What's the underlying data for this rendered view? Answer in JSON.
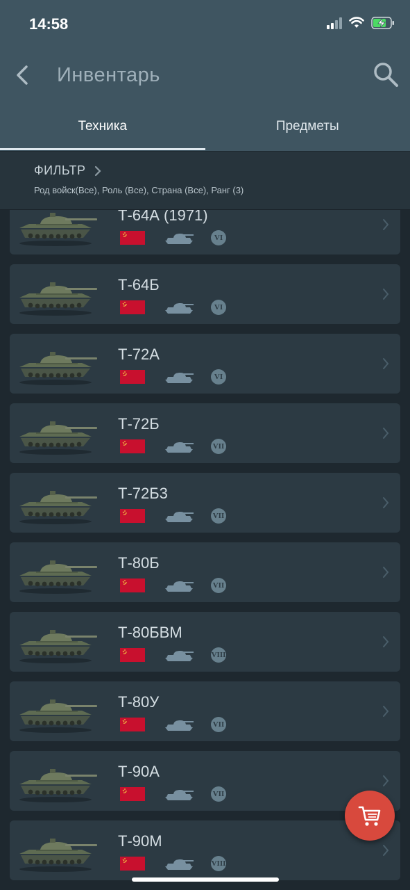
{
  "status": {
    "time": "14:58"
  },
  "nav": {
    "title": "Инвентарь"
  },
  "tabs": [
    {
      "label": "Техника",
      "active": true
    },
    {
      "label": "Предметы",
      "active": false
    }
  ],
  "filter": {
    "title": "ФИЛЬТР",
    "summary": "Род войск(Все), Роль (Все), Страна (Все), Ранг (3)"
  },
  "colors": {
    "accent_cart": "#d8493d",
    "flag": "#c8102e",
    "header": "#3f5561"
  },
  "vehicles": [
    {
      "name": "Т-64А (1971)",
      "country": "ussr-flag",
      "type": "tank-icon",
      "rank": "VI"
    },
    {
      "name": "Т-64Б",
      "country": "ussr-flag",
      "type": "tank-icon",
      "rank": "VI"
    },
    {
      "name": "Т-72А",
      "country": "ussr-flag",
      "type": "tank-icon",
      "rank": "VI"
    },
    {
      "name": "Т-72Б",
      "country": "ussr-flag",
      "type": "tank-icon",
      "rank": "VII"
    },
    {
      "name": "Т-72Б3",
      "country": "ussr-flag",
      "type": "tank-icon",
      "rank": "VII"
    },
    {
      "name": "Т-80Б",
      "country": "ussr-flag",
      "type": "tank-icon",
      "rank": "VII"
    },
    {
      "name": "Т-80БВМ",
      "country": "ussr-flag",
      "type": "tank-icon",
      "rank": "VIII"
    },
    {
      "name": "Т-80У",
      "country": "ussr-flag",
      "type": "tank-icon",
      "rank": "VII"
    },
    {
      "name": "Т-90А",
      "country": "ussr-flag",
      "type": "tank-icon",
      "rank": "VII"
    },
    {
      "name": "Т-90М",
      "country": "ussr-flag",
      "type": "tank-icon",
      "rank": "VIII"
    }
  ]
}
